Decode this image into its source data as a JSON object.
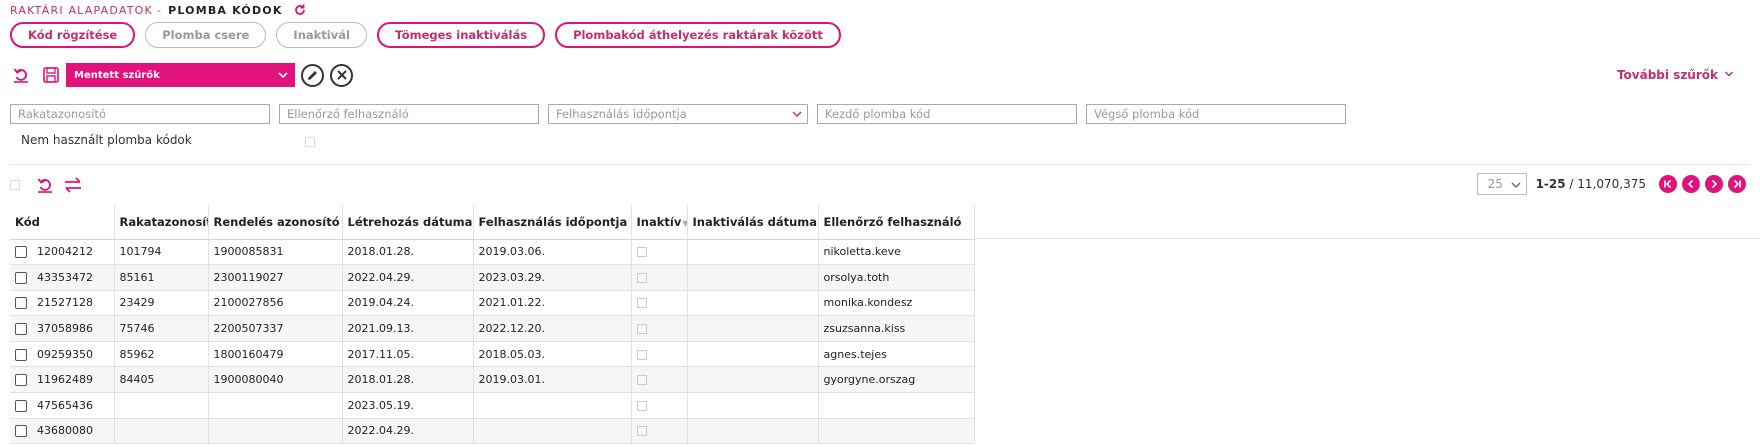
{
  "breadcrumb": {
    "parent": "RAKTÁRI ALAPADATOK",
    "separator": "-",
    "title": "PLOMBA KÓDOK"
  },
  "actions": [
    {
      "label": "Kód rögzítése",
      "enabled": true
    },
    {
      "label": "Plomba csere",
      "enabled": false
    },
    {
      "label": "Inaktivál",
      "enabled": false
    },
    {
      "label": "Tömeges inaktiválás",
      "enabled": true
    },
    {
      "label": "Plombakód áthelyezés raktárak között",
      "enabled": true
    }
  ],
  "toolbar": {
    "saved_filters_label": "Mentett szűrők"
  },
  "more_filters_label": "További szűrők",
  "filters": {
    "rakatazonosito": "Rakatazonosító",
    "ellenorzo": "Ellenőrző felhasználó",
    "felhasznalas": "Felhasználás időpontja",
    "kezdo": "Kezdő plomba kód",
    "vegso": "Végső plomba kód"
  },
  "unused_label": "Nem használt plomba kódok",
  "pager": {
    "page_size": "25",
    "range": "1-25",
    "separator": " / ",
    "total": "11,070,375"
  },
  "columns": [
    "Kód",
    "Rakatazonosító",
    "Rendelés azonosító",
    "Létrehozás dátuma",
    "Felhasználás időpontja",
    "Inaktív",
    "Inaktiválás dátuma",
    "Ellenőrző felhasználó"
  ],
  "rows": [
    {
      "kod": "12004212",
      "rakat": "101794",
      "rendeles": "1900085831",
      "letrehozas": "2018.01.28.",
      "felhasznalas": "2019.03.06.",
      "inakt_datum": "",
      "ellenorzo": "nikoletta.keve"
    },
    {
      "kod": "43353472",
      "rakat": "85161",
      "rendeles": "2300119027",
      "letrehozas": "2022.04.29.",
      "felhasznalas": "2023.03.29.",
      "inakt_datum": "",
      "ellenorzo": "orsolya.toth"
    },
    {
      "kod": "21527128",
      "rakat": "23429",
      "rendeles": "2100027856",
      "letrehozas": "2019.04.24.",
      "felhasznalas": "2021.01.22.",
      "inakt_datum": "",
      "ellenorzo": "monika.kondesz"
    },
    {
      "kod": "37058986",
      "rakat": "75746",
      "rendeles": "2200507337",
      "letrehozas": "2021.09.13.",
      "felhasznalas": "2022.12.20.",
      "inakt_datum": "",
      "ellenorzo": "zsuzsanna.kiss"
    },
    {
      "kod": "09259350",
      "rakat": "85962",
      "rendeles": "1800160479",
      "letrehozas": "2017.11.05.",
      "felhasznalas": "2018.05.03.",
      "inakt_datum": "",
      "ellenorzo": "agnes.tejes"
    },
    {
      "kod": "11962489",
      "rakat": "84405",
      "rendeles": "1900080040",
      "letrehozas": "2018.01.28.",
      "felhasznalas": "2019.03.01.",
      "inakt_datum": "",
      "ellenorzo": "gyorgyne.orszag"
    },
    {
      "kod": "47565436",
      "rakat": "",
      "rendeles": "",
      "letrehozas": "2023.05.19.",
      "felhasznalas": "",
      "inakt_datum": "",
      "ellenorzo": ""
    },
    {
      "kod": "43680080",
      "rakat": "",
      "rendeles": "",
      "letrehozas": "2022.04.29.",
      "felhasznalas": "",
      "inakt_datum": "",
      "ellenorzo": ""
    }
  ],
  "colors": {
    "accent": "#e0127c",
    "accent_text": "#c0306e",
    "disabled": "#bbbbbb"
  }
}
